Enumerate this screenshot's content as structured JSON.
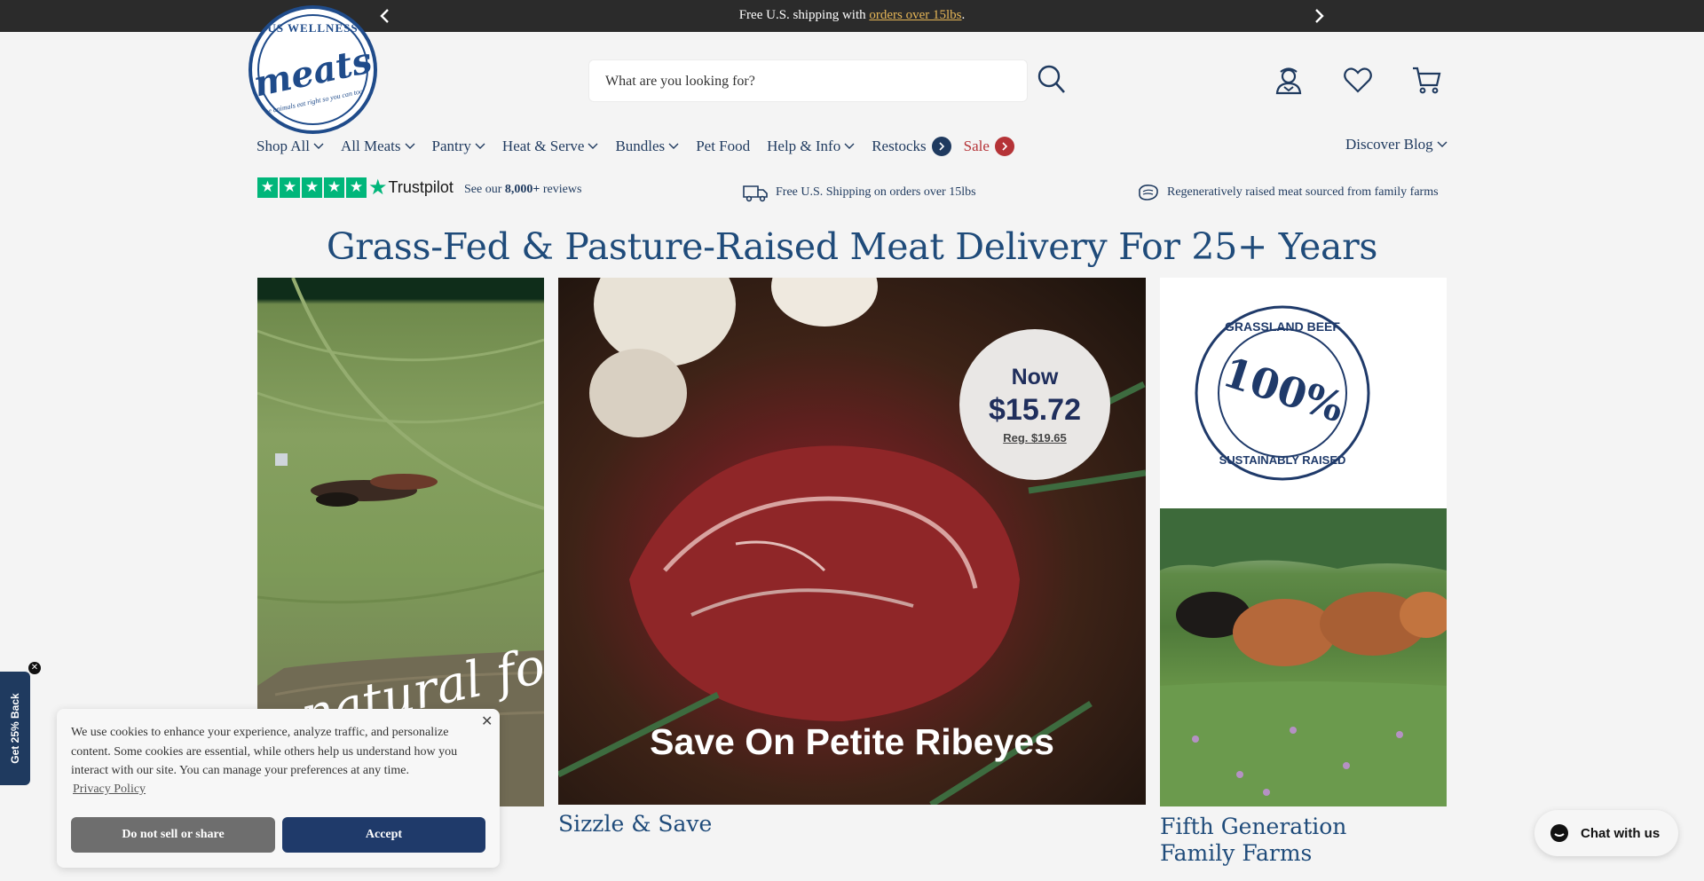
{
  "announcement": {
    "prefix": "Free U.S. shipping with ",
    "link": "orders over 15lbs",
    "suffix": "."
  },
  "logo": {
    "top": "US WELLNESS",
    "wordmark": "meats",
    "tagline": "the animals eat right so you can too"
  },
  "search": {
    "placeholder": "What are you looking for?"
  },
  "header_icons": [
    "search-icon",
    "account-icon",
    "heart-icon",
    "cart-icon"
  ],
  "nav": {
    "items": [
      {
        "label": "Shop All",
        "dropdown": true
      },
      {
        "label": "All Meats",
        "dropdown": true
      },
      {
        "label": "Pantry",
        "dropdown": true
      },
      {
        "label": "Heat & Serve",
        "dropdown": true
      },
      {
        "label": "Bundles",
        "dropdown": true
      },
      {
        "label": "Pet Food",
        "dropdown": false
      },
      {
        "label": "Help & Info",
        "dropdown": true
      },
      {
        "label": "Restocks",
        "dropdown": false
      },
      {
        "label": "Sale",
        "dropdown": false
      }
    ],
    "right": "Discover Blog"
  },
  "trust": {
    "brand": "Trustpilot",
    "reviews_prefix": "See our ",
    "reviews_count": "8,000+",
    "reviews_suffix": " reviews",
    "shipping": "Free U.S. Shipping on orders over 15lbs",
    "sourcing": "Regeneratively raised meat sourced from family farms"
  },
  "hero": {
    "title": "Grass-Fed & Pasture-Raised Meat Delivery For 25+ Years"
  },
  "tiles": {
    "left": {
      "overlay": "natural food"
    },
    "middle": {
      "badge_now": "Now",
      "badge_price": "$15.72",
      "badge_reg": "Reg. $19.65",
      "overlay": "Save On Petite Ribeyes",
      "caption": "Sizzle & Save"
    },
    "right": {
      "seal_top": "GRASSLAND BEEF",
      "seal_center": "100%",
      "seal_bottom": "SUSTAINABLY RAISED",
      "caption": "Fifth Generation Family Farms"
    }
  },
  "side_tab": {
    "label": "Get 25% Back"
  },
  "cookie": {
    "message": "We use cookies to enhance your experience, analyze traffic, and personalize content. Some cookies are essential, while others help us understand how you interact with our site. You can manage your preferences at any time.",
    "policy": "Privacy Policy",
    "dns_button": "Do not sell or share",
    "accept_button": "Accept"
  },
  "chat": {
    "label": "Chat with us"
  },
  "colors": {
    "navy": "#1f3a5f",
    "sale_red": "#b53337",
    "trustpilot_green": "#00b67a",
    "announce_bg": "#2b2b2b"
  }
}
